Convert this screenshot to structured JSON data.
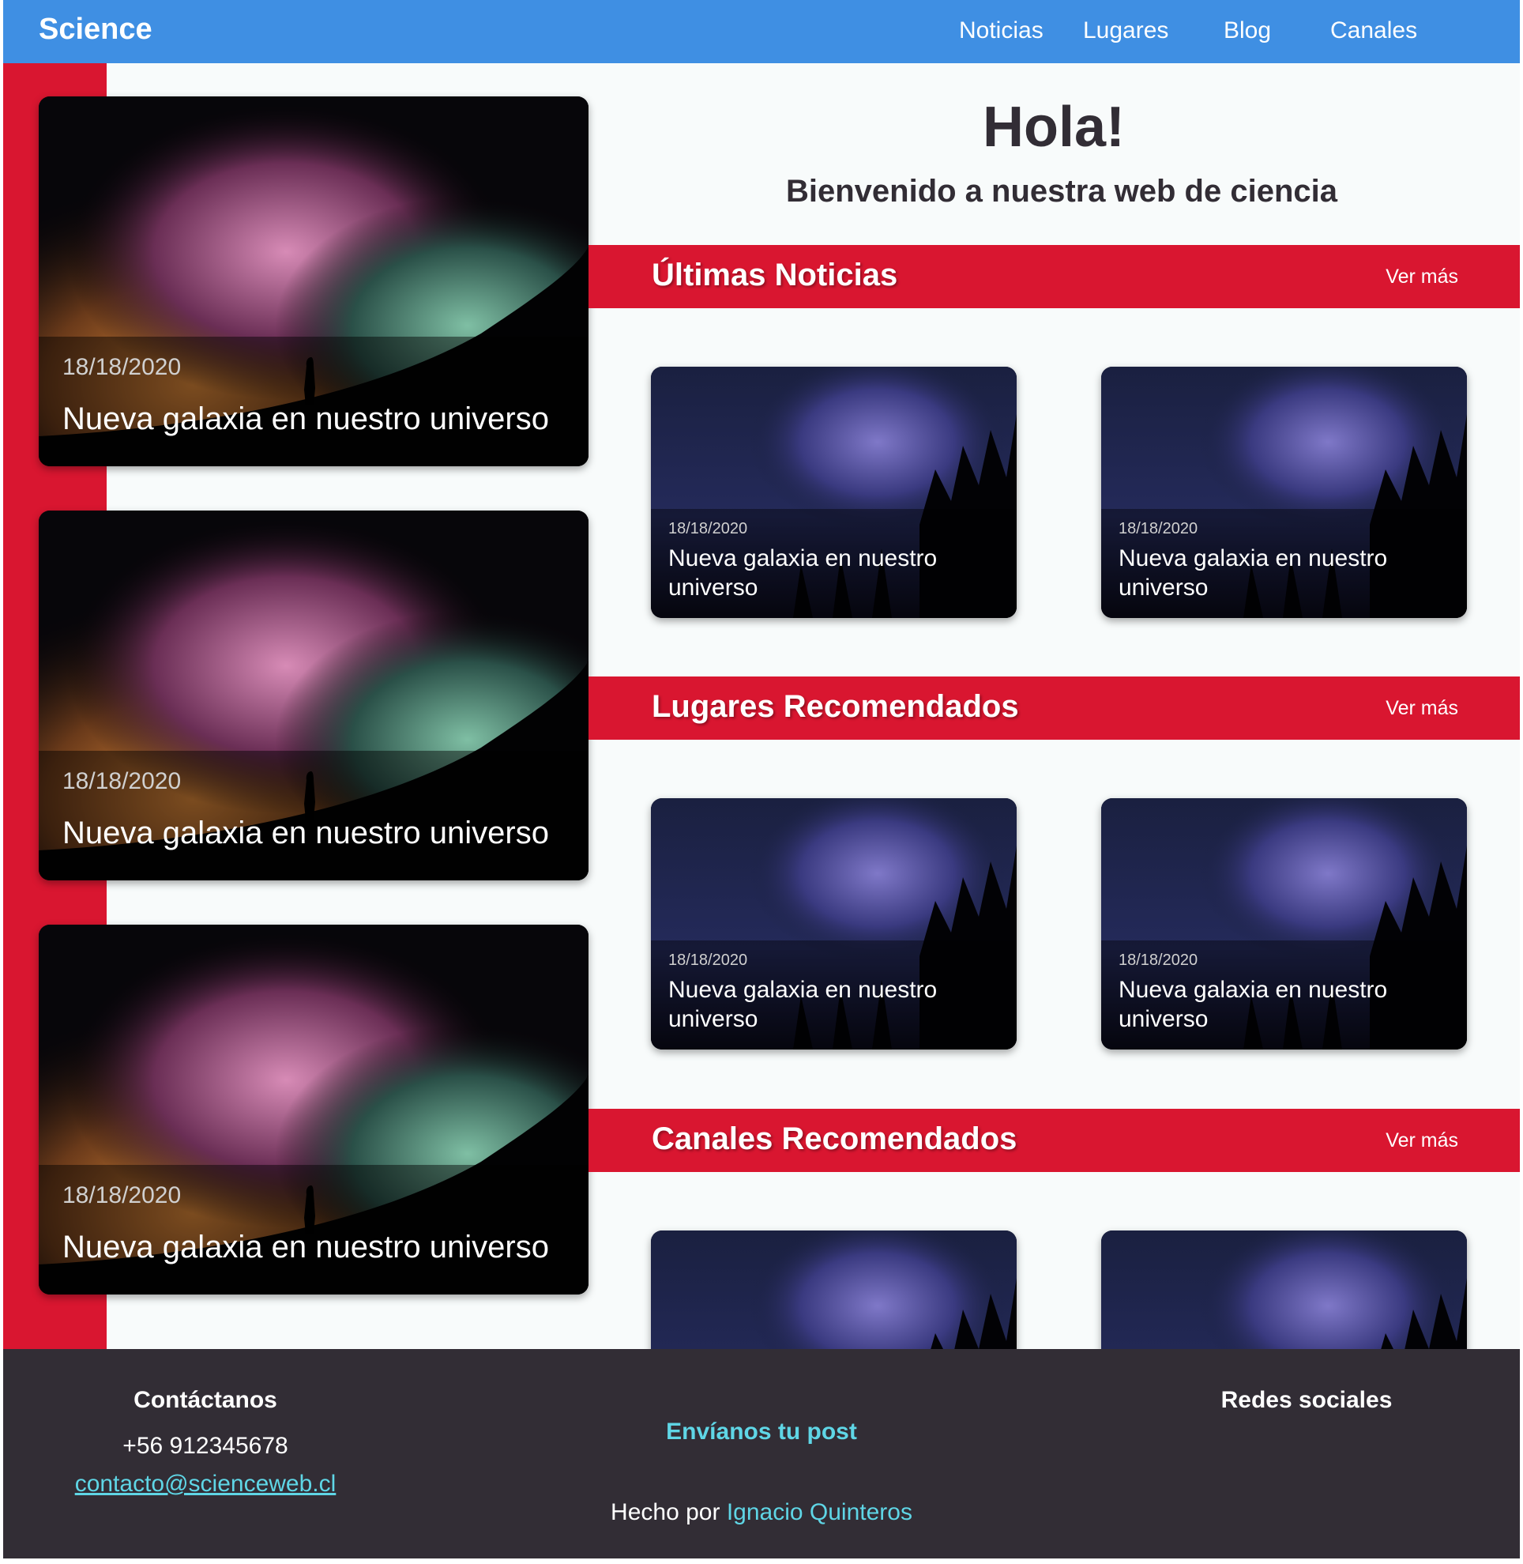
{
  "header": {
    "brand": "Science",
    "nav": [
      "Noticias",
      "Lugares",
      "Blog",
      "Canales"
    ]
  },
  "hero": {
    "title": "Hola!",
    "subtitle": "Bienvenido a nuestra web de ciencia"
  },
  "featured": [
    {
      "date": "18/18/2020",
      "title": "Nueva galaxia en nuestro universo"
    },
    {
      "date": "18/18/2020",
      "title": "Nueva galaxia en nuestro universo"
    },
    {
      "date": "18/18/2020",
      "title": "Nueva galaxia en nuestro universo"
    }
  ],
  "sections": [
    {
      "title": "Últimas Noticias",
      "more": "Ver más",
      "cards": [
        {
          "date": "18/18/2020",
          "title": "Nueva galaxia en nuestro universo"
        },
        {
          "date": "18/18/2020",
          "title": "Nueva galaxia en nuestro universo"
        }
      ]
    },
    {
      "title": "Lugares Recomendados",
      "more": "Ver más",
      "cards": [
        {
          "date": "18/18/2020",
          "title": "Nueva galaxia en nuestro universo"
        },
        {
          "date": "18/18/2020",
          "title": "Nueva galaxia en nuestro universo"
        }
      ]
    },
    {
      "title": "Canales Recomendados",
      "more": "Ver más",
      "cards": [
        {
          "date": "",
          "title": ""
        },
        {
          "date": "",
          "title": ""
        }
      ]
    }
  ],
  "footer": {
    "contact_heading": "Contáctanos",
    "phone": "+56 912345678",
    "email": "contacto@scienceweb.cl",
    "post_link": "Envíanos tu post",
    "made_by_prefix": "Hecho por",
    "author": "Ignacio Quinteros",
    "social_heading": "Redes sociales"
  },
  "colors": {
    "header_blue": "#3f8fe3",
    "accent_red": "#d91630",
    "footer_dark": "#322d35",
    "link_cyan": "#5fd6e6"
  }
}
